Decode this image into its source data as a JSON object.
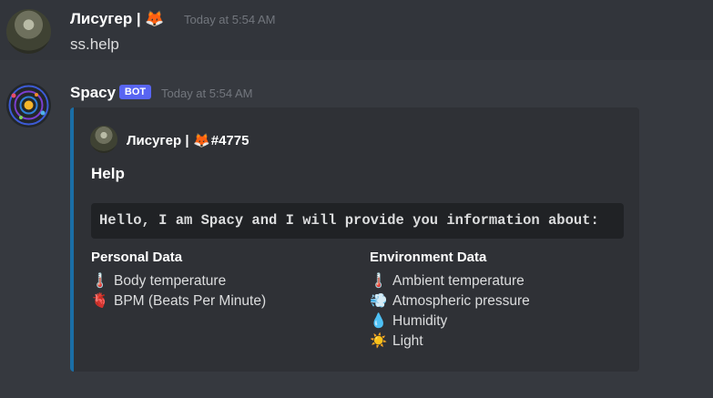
{
  "message1": {
    "username": "Лисугер |",
    "username_emoji": "🦊",
    "timestamp": "Today at 5:54 AM",
    "content": "ss.help"
  },
  "message2": {
    "username": "Spacy",
    "bot_tag": "BOT",
    "timestamp": "Today at 5:54 AM",
    "embed": {
      "accent_color": "#1a6ea6",
      "author_name": "Лисугер |",
      "author_emoji": "🦊",
      "author_tag": "#4775",
      "title": "Help",
      "code": "Hello, I am Spacy and I will provide you information about:",
      "fields": [
        {
          "name": "Personal Data",
          "lines": [
            {
              "icon": "🌡️",
              "text": "Body temperature"
            },
            {
              "icon": "🫀",
              "text": "BPM (Beats Per Minute)"
            }
          ]
        },
        {
          "name": "Environment Data",
          "lines": [
            {
              "icon": "🌡️",
              "text": "Ambient temperature"
            },
            {
              "icon": "💨",
              "text": "Atmospheric pressure"
            },
            {
              "icon": "💧",
              "text": "Humidity"
            },
            {
              "icon": "☀️",
              "text": "Light"
            }
          ]
        }
      ]
    }
  },
  "colors": {
    "background": "#36393f",
    "hover_background": "#32353b",
    "embed_background": "#2f3136",
    "bot_tag": "#5865f2",
    "timestamp": "#72767d"
  }
}
